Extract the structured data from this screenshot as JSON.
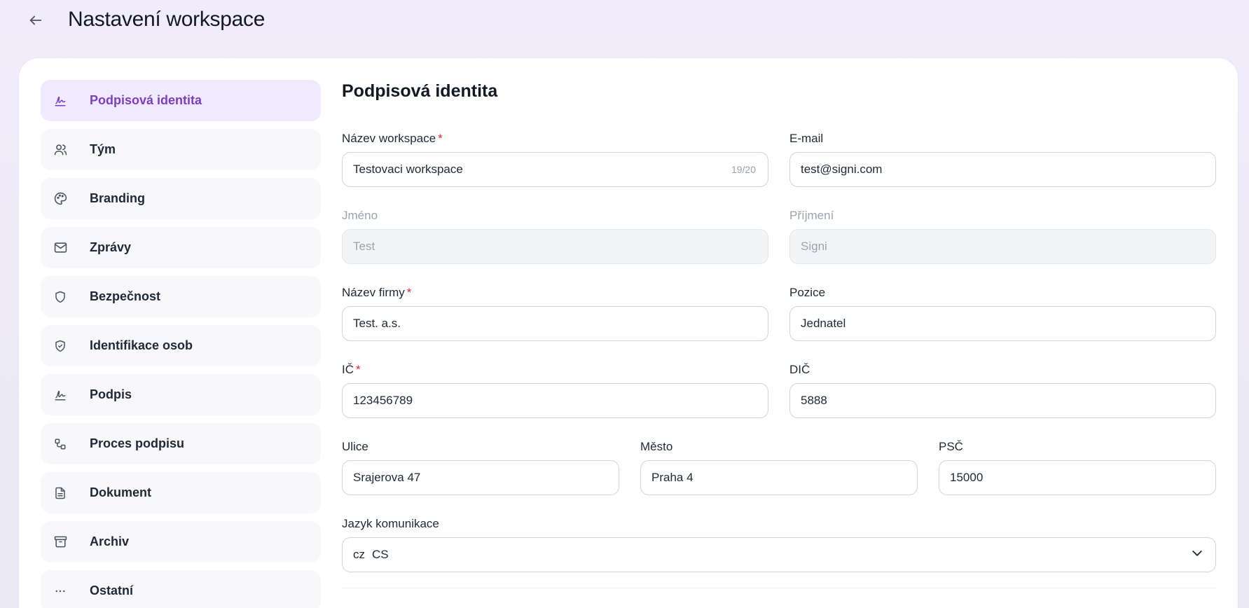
{
  "header": {
    "title": "Nastavení workspace"
  },
  "sidebar": {
    "items": [
      {
        "label": "Podpisová identita",
        "icon": "signature-icon",
        "active": true
      },
      {
        "label": "Tým",
        "icon": "users-icon",
        "active": false
      },
      {
        "label": "Branding",
        "icon": "palette-icon",
        "active": false
      },
      {
        "label": "Zprávy",
        "icon": "mail-icon",
        "active": false
      },
      {
        "label": "Bezpečnost",
        "icon": "shield-icon",
        "active": false
      },
      {
        "label": "Identifikace osob",
        "icon": "shield-check-icon",
        "active": false
      },
      {
        "label": "Podpis",
        "icon": "signature-icon",
        "active": false
      },
      {
        "label": "Proces podpisu",
        "icon": "workflow-icon",
        "active": false
      },
      {
        "label": "Dokument",
        "icon": "document-icon",
        "active": false
      },
      {
        "label": "Archiv",
        "icon": "archive-icon",
        "active": false
      },
      {
        "label": "Ostatní",
        "icon": "more-icon",
        "active": false
      }
    ]
  },
  "form": {
    "title": "Podpisová identita",
    "workspace_name": {
      "label": "Název workspace",
      "value": "Testovaci workspace",
      "counter": "19/20",
      "required": true
    },
    "email": {
      "label": "E-mail",
      "value": "test@signi.com"
    },
    "first_name": {
      "label": "Jméno",
      "value": "Test",
      "disabled": true
    },
    "last_name": {
      "label": "Příjmení",
      "value": "Signi",
      "disabled": true
    },
    "company": {
      "label": "Název firmy",
      "value": "Test. a.s.",
      "required": true
    },
    "position": {
      "label": "Pozice",
      "value": "Jednatel"
    },
    "ic": {
      "label": "IČ",
      "value": "123456789",
      "required": true
    },
    "dic": {
      "label": "DIČ",
      "value": "5888"
    },
    "street": {
      "label": "Ulice",
      "value": "Srajerova 47"
    },
    "city": {
      "label": "Město",
      "value": "Praha 4"
    },
    "zip": {
      "label": "PSČ",
      "value": "15000"
    },
    "language": {
      "label": "Jazyk komunikace",
      "flag": "cz",
      "value": "CS"
    },
    "required_mark": "*"
  },
  "colors": {
    "accent": "#7b3fc4",
    "active_bg": "#f1e9fd",
    "required": "#dc2626"
  }
}
